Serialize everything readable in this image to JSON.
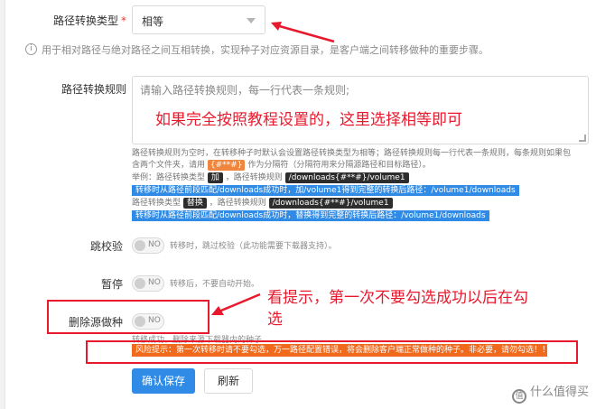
{
  "path_type": {
    "label": "路径转换类型",
    "required_mark": "*",
    "selected": "相等",
    "hint": "用于相对路径与绝对路径之间互相转换，实现种子对应资源目录，是客户端之间转移做种的重要步骤。"
  },
  "rules": {
    "label": "路径转换规则",
    "placeholder": "请输入路径转换规则，每一行代表一条规则;",
    "help": {
      "line1": "路径转换规则为空时，在转移种子时默认会设置路径转换类型为相等；路径转换规则每一行代表一条规则，每条规则如果包",
      "line2_a": "含两个文件夹，请用",
      "line2_code": "{#**#}",
      "line2_b": "作为分隔符（分隔符用来分隔源路径和目标路径）。",
      "ex1_a": "举例：路径转换类型",
      "ex1_code1": "加",
      "ex1_b": "，路径转换规则",
      "ex1_code2": "/downloads{#**#}/volume1",
      "ex1_result": "转移时从路径前段匹配/downloads成功时，加/volume1得到完整的转换后路径：/volume1/downloads",
      "ex2_a": "路径转换类型",
      "ex2_code1": "替换",
      "ex2_b": "，路径转换规则",
      "ex2_code2": "/downloads{#**#}/volume1",
      "ex2_result": "转移时从路径前段匹配/downloads成功时，替换得到完整的转换后路径：/volume1/downloads"
    }
  },
  "skip_check": {
    "label": "跳校验",
    "toggle": "NO",
    "hint": "转移时，跳过校验（此功能需要下载器支持）。"
  },
  "pause": {
    "label": "暂停",
    "toggle": "NO",
    "hint": "转移后，不要自动开始。"
  },
  "delete_source": {
    "label": "删除源做种",
    "toggle": "NO",
    "hint": "转移成功，删除来源下载器内的种子"
  },
  "risk_warning": "风险提示：第一次转移时请不要勾选，万一路径配置错误，将会删除客户端正常做种的种子。非必要，请勿勾选！！！",
  "buttons": {
    "confirm": "确认保存",
    "refresh": "刷新"
  },
  "annotations": {
    "select_note": "如果完全按照教程设置的，这里选择相等即可",
    "check_note_line1": "看提示，第一次不要勾选成功以后在勾",
    "check_note_line2": "选"
  },
  "watermark": "什么值得买",
  "colors": {
    "annotation_red": "#e8192c",
    "primary_blue": "#2f8be6",
    "warning_orange": "#f06a1d"
  }
}
